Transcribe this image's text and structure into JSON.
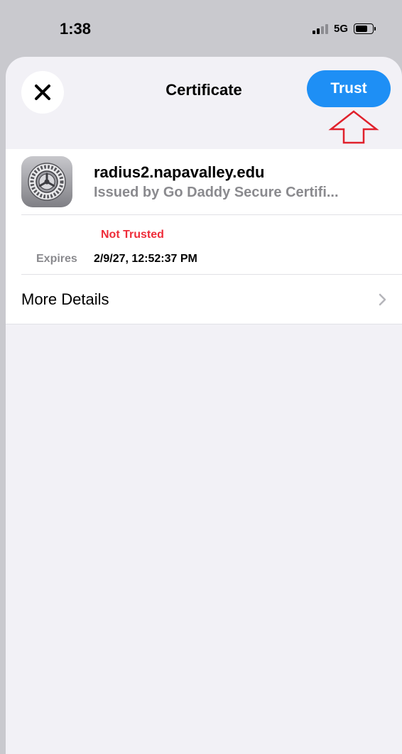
{
  "status_bar": {
    "time": "1:38",
    "network": "5G",
    "icons": [
      "cellular-signal-icon",
      "battery-icon"
    ]
  },
  "header": {
    "title": "Certificate",
    "close_icon": "close-icon",
    "trust_label": "Trust",
    "annotation_icon": "up-arrow-annotation-icon"
  },
  "certificate": {
    "name": "radius2.napavalley.edu",
    "issuer": "Issued by Go Daddy Secure Certifi...",
    "icon": "settings-gear-icon",
    "status": "Not Trusted",
    "expires_label": "Expires",
    "expires_value": "2/9/27, 12:52:37 PM"
  },
  "more_details": {
    "label": "More Details",
    "icon": "chevron-right-icon"
  },
  "colors": {
    "accent": "#1e8ff5",
    "danger": "#ee2c39",
    "secondary_text": "#8a8a8e",
    "background": "#f2f1f6",
    "annotation": "#e0212c"
  }
}
